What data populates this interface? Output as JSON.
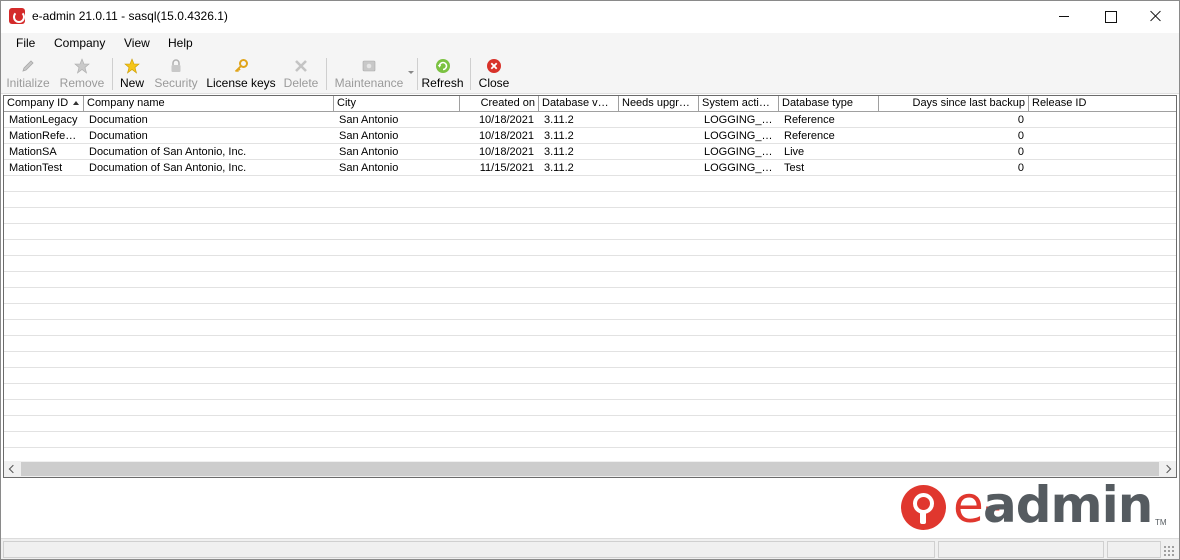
{
  "window": {
    "title": "e-admin 21.0.11 - sasql(15.0.4326.1)"
  },
  "menu": [
    "File",
    "Company",
    "View",
    "Help"
  ],
  "toolbar": {
    "initialize": "Initialize",
    "remove": "Remove",
    "new": "New",
    "security": "Security",
    "license_keys": "License keys",
    "delete": "Delete",
    "maintenance": "Maintenance",
    "refresh": "Refresh",
    "close": "Close"
  },
  "grid": {
    "columns": [
      "Company ID",
      "Company name",
      "City",
      "Created on",
      "Database v…",
      "Needs upgr…",
      "System acti…",
      "Database type",
      "Days since last backup",
      "Release ID"
    ],
    "rows": [
      [
        "MationLegacy",
        "Documation",
        "San Antonio",
        "10/18/2021",
        "3.11.2",
        "",
        "LOGGING_…",
        "Reference",
        "0",
        ""
      ],
      [
        "MationRefe…",
        "Documation",
        "San Antonio",
        "10/18/2021",
        "3.11.2",
        "",
        "LOGGING_…",
        "Reference",
        "0",
        ""
      ],
      [
        "MationSA",
        "Documation of San Antonio, Inc.",
        "San Antonio",
        "10/18/2021",
        "3.11.2",
        "",
        "LOGGING_…",
        "Live",
        "0",
        ""
      ],
      [
        "MationTest",
        "Documation of San Antonio, Inc.",
        "San Antonio",
        "11/15/2021",
        "3.11.2",
        "",
        "LOGGING_…",
        "Test",
        "0",
        ""
      ]
    ]
  },
  "logo": {
    "e": "e-",
    "admin": "admin",
    "tm": "TM"
  },
  "colors": {
    "accent_red": "#e0372e",
    "logo_gray": "#555b60"
  }
}
